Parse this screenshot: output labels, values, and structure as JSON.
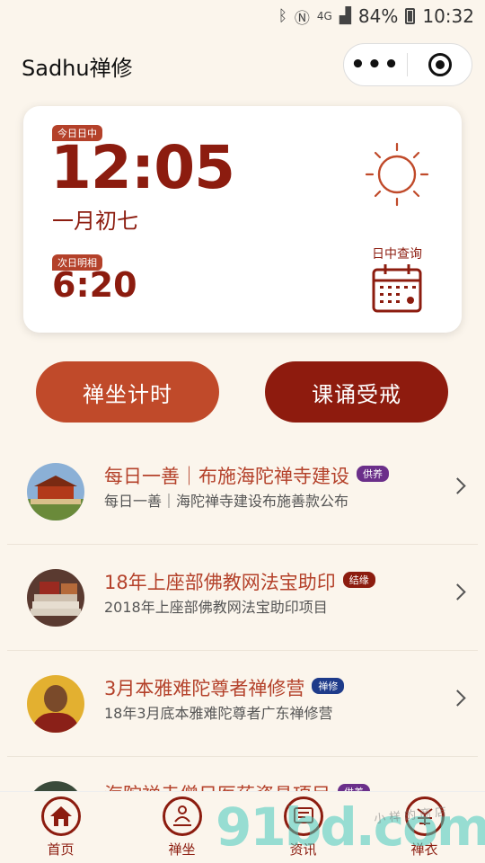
{
  "status": {
    "network": "4G",
    "battery": "84%",
    "time": "10:32"
  },
  "app": {
    "title": "Sadhu禅修"
  },
  "card": {
    "today_tag": "今日日中",
    "today_time": "12:05",
    "lunar_date": "一月初七",
    "next_tag": "次日明相",
    "next_time": "6:20",
    "query_label": "日中查询"
  },
  "buttons": {
    "meditation_timer": "禅坐计时",
    "chanting": "课诵受戒"
  },
  "list": [
    {
      "title": "每日一善｜布施海陀禅寺建设",
      "badge": "供养",
      "badge_color": "#6b2f8a",
      "subtitle": "每日一善｜海陀禅寺建设布施善款公布",
      "avatar_icon": "temple-thumbnail"
    },
    {
      "title": "18年上座部佛教网法宝助印",
      "badge": "结缘",
      "badge_color": "#8c1c0f",
      "subtitle": "2018年上座部佛教网法宝助印项目",
      "avatar_icon": "books-thumbnail"
    },
    {
      "title": "3月本雅难陀尊者禅修营",
      "badge": "禅修",
      "badge_color": "#1e3b8a",
      "subtitle": "18年3月底本雅难陀尊者广东禅修营",
      "avatar_icon": "monk-thumbnail"
    },
    {
      "title": "海陀禅寺僧日医药资具项目",
      "badge": "供养",
      "badge_color": "#6b2f8a",
      "subtitle": "",
      "avatar_icon": "temple-thumbnail"
    }
  ],
  "tabs": [
    {
      "label": "首页",
      "icon": "home-icon"
    },
    {
      "label": "禅坐",
      "icon": "meditation-icon"
    },
    {
      "label": "资讯",
      "icon": "news-icon"
    },
    {
      "label": "禅衣",
      "icon": "robe-icon"
    }
  ],
  "watermark": {
    "text": "91bd.com",
    "sub": "小样的商店"
  }
}
